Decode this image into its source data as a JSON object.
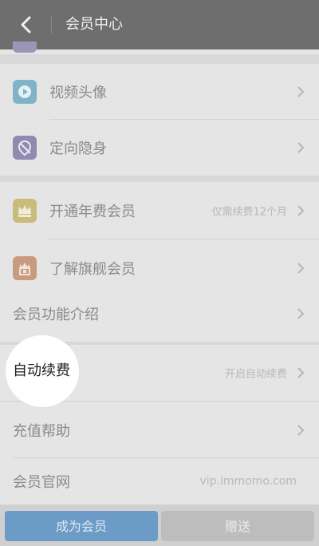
{
  "header": {
    "title": "会员中心"
  },
  "menu": {
    "video_avatar": "视频头像",
    "targeted_invisible": "定向隐身",
    "annual_member": "开通年费会员",
    "annual_member_hint": "仅需续费12个月",
    "flagship_member": "了解旗舰会员",
    "features_intro": "会员功能介绍",
    "auto_renew": "自动续费",
    "auto_renew_hint": "开启自动续费",
    "recharge_help": "充值帮助",
    "official_site": "会员官网",
    "official_site_url": "vip.immomo.com"
  },
  "footer": {
    "become_member": "成为会员",
    "gift": "赠送"
  },
  "icons": {
    "video_avatar": "video-play-icon",
    "targeted_invisible": "location-hide-icon",
    "annual_member": "crown-icon",
    "flagship_member": "flag-crown-icon"
  },
  "colors": {
    "header": "#6e6e6e",
    "primary_button": "#6b9bc6"
  }
}
